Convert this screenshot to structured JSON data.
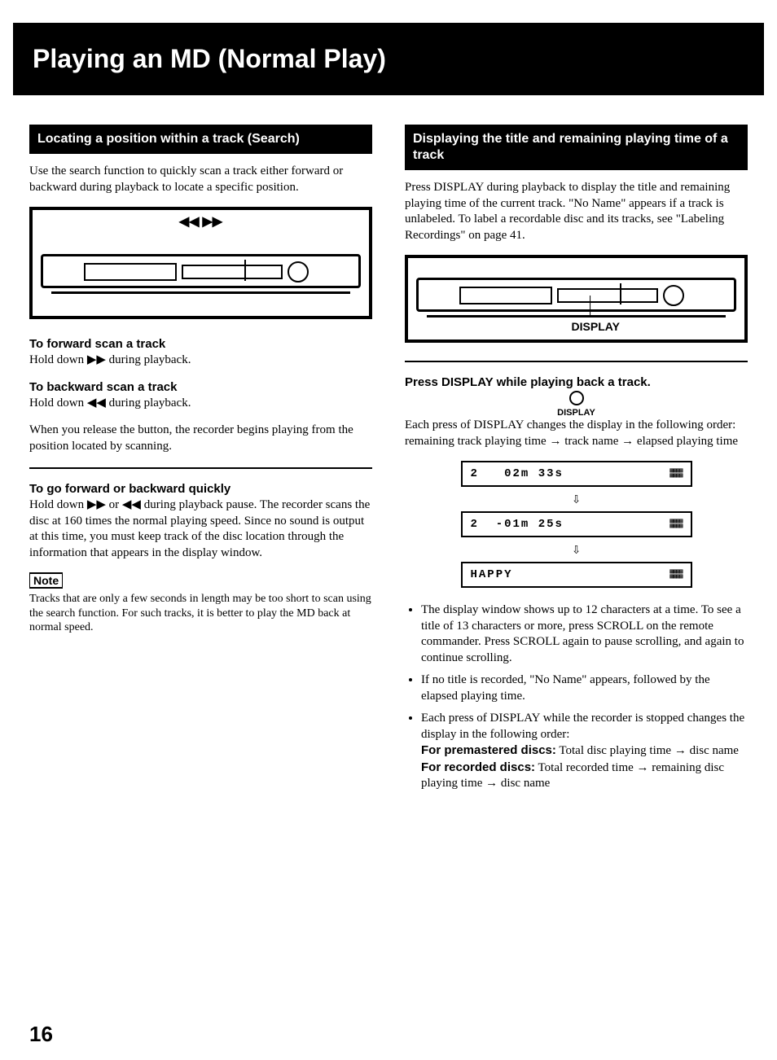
{
  "page_number": "16",
  "title": "Playing an MD (Normal Play)",
  "left": {
    "heading": "Locating a position within a track (Search)",
    "intro": "Use the search function to quickly scan a track either forward or backward during playback to locate a specific position.",
    "device_arrows": "◀◀ ▶▶",
    "fwd_head": "To forward scan a track",
    "fwd_body": "Hold down ▶▶ during playback.",
    "bwd_head": "To backward scan a track",
    "bwd_body": "Hold down ◀◀ during playback.",
    "release": "When you release the button, the recorder begins playing from the position located by scanning.",
    "quick_head": "To go forward or backward quickly",
    "quick_body": "Hold down ▶▶ or ◀◀ during playback pause. The recorder scans the disc at 160 times the normal playing speed. Since no sound is output at this time, you must keep track of the disc location through the information that appears in the display window.",
    "note_label": "Note",
    "note_body": "Tracks that are only a few seconds in length may be too short to scan using the search function. For such tracks, it is better to play the MD back at normal speed."
  },
  "right": {
    "heading": "Displaying the title and remaining playing time of a track",
    "intro": "Press DISPLAY during playback to display the title and remaining playing time of the current track. \"No Name\" appears if a track is unlabeled. To label a recordable disc and its tracks, see \"Labeling Recordings\" on page 41.",
    "device_callout": "DISPLAY",
    "press_head": "Press DISPLAY while playing back a track.",
    "press_icon_label": "DISPLAY",
    "press_body": "Each press of DISPLAY changes the display in the following order: remaining track playing time → track name → elapsed playing time",
    "lcd1_trk": "2",
    "lcd1_time": "02m 33s",
    "lcd2_trk": "2",
    "lcd2_time": "-01m 25s",
    "lcd3_text": "HAPPY",
    "bullets": [
      "The display window shows up to 12 characters at a time. To see a title of 13 characters or more, press SCROLL on the remote commander. Press SCROLL again to pause scrolling, and again to continue scrolling.",
      "If no title is recorded, \"No Name\" appears, followed by the elapsed playing time.",
      "Each press of DISPLAY while the recorder is stopped changes the display in the following order:"
    ],
    "stopped_pre_label": "For premastered discs:",
    "stopped_pre_body": "Total disc playing time → disc name",
    "stopped_rec_label": "For recorded discs:",
    "stopped_rec_body": "Total recorded time → remaining disc playing time → disc name"
  }
}
